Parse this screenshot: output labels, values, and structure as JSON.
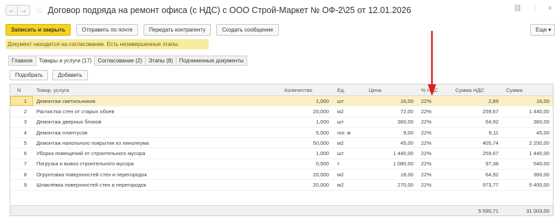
{
  "window": {
    "title": "Договор подряда на ремонт офиса (с НДС) с ООО Строй-Маркет № ОФ-2\\25 от 12.01.2026",
    "nav_back": "←",
    "nav_forward": "→",
    "star": "☆",
    "icons": [
      "link-icon",
      "more-vertical-icon",
      "close-icon"
    ],
    "icon_glyphs": {
      "link": "⛓",
      "more": "⋮",
      "close": "×"
    }
  },
  "toolbar": {
    "save_close": "Записать и закрыть",
    "send_email": "Отправить по почте",
    "send_counterparty": "Передать контрагенту",
    "create_message": "Создать сообщение",
    "more": "Еще ▾"
  },
  "info_bar": "Документ находится на согласовании.  Есть незавершенные этапы.",
  "tabs": [
    {
      "label": "Главное",
      "active": false
    },
    {
      "label": "Товары и услуги (17)",
      "active": true
    },
    {
      "label": "Согласование (2)",
      "active": false
    },
    {
      "label": "Этапы (8)",
      "active": false
    },
    {
      "label": "Подчиненные документы",
      "active": false
    }
  ],
  "table_toolbar": {
    "pick": "Подобрать",
    "add": "Добавить"
  },
  "table": {
    "columns": [
      "N",
      "Товар, услуга",
      "Количество",
      "Ед.",
      "Цена",
      "% НДС",
      "Сумма НДС",
      "Сумма"
    ],
    "rows": [
      {
        "n": "1",
        "name": "Демонтаж светильников",
        "qty": "1,000",
        "unit": "шт",
        "price": "16,00",
        "vat": "22%",
        "vat_sum": "2,89",
        "sum": "16,00",
        "selected": true
      },
      {
        "n": "2",
        "name": "Расчистка стен от старых обоев",
        "qty": "20,000",
        "unit": "м2",
        "price": "72,00",
        "vat": "22%",
        "vat_sum": "259,67",
        "sum": "1 440,00"
      },
      {
        "n": "3",
        "name": "Демонтаж дверных блоков",
        "qty": "1,000",
        "unit": "шт",
        "price": "360,00",
        "vat": "22%",
        "vat_sum": "64,92",
        "sum": "360,00"
      },
      {
        "n": "4",
        "name": "Демонтаж плинтусов",
        "qty": "5,000",
        "unit": "пог. м",
        "price": "9,00",
        "vat": "22%",
        "vat_sum": "8,11",
        "sum": "45,00"
      },
      {
        "n": "5",
        "name": "Демонтаж напольного покрытия из линолеума",
        "qty": "50,000",
        "unit": "м2",
        "price": "45,00",
        "vat": "22%",
        "vat_sum": "405,74",
        "sum": "2 250,00"
      },
      {
        "n": "6",
        "name": "Уборка помещений от строительного мусора",
        "qty": "1,000",
        "unit": "шт",
        "price": "1 440,00",
        "vat": "22%",
        "vat_sum": "259,67",
        "sum": "1 440,00"
      },
      {
        "n": "7",
        "name": "Погрузка и вывоз строительного мусора",
        "qty": "0,500",
        "unit": "т",
        "price": "1 080,00",
        "vat": "22%",
        "vat_sum": "97,38",
        "sum": "540,00"
      },
      {
        "n": "8",
        "name": "Огрунтовка поверхностей стен и перегородок",
        "qty": "20,000",
        "unit": "м2",
        "price": "18,00",
        "vat": "22%",
        "vat_sum": "64,92",
        "sum": "360,00"
      },
      {
        "n": "9",
        "name": "Шпаклёвка поверхностей стен и перегородок",
        "qty": "20,000",
        "unit": "м2",
        "price": "270,00",
        "vat": "22%",
        "vat_sum": "973,77",
        "sum": "5 400,00"
      }
    ],
    "totals": {
      "vat_sum": "5 590,71",
      "sum": "31 003,00"
    }
  },
  "colors": {
    "primary_button": "#f5d323",
    "info_bar": "#f7eb9f",
    "selected_row": "#fbf0c3",
    "annotation_arrow": "#e11b1b"
  }
}
